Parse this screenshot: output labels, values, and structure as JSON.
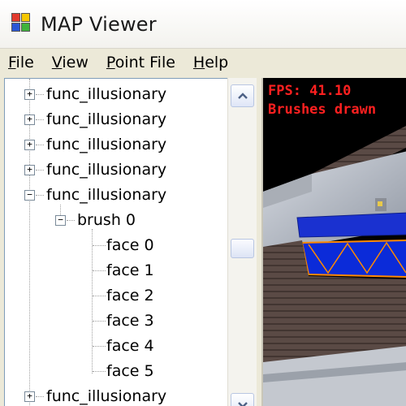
{
  "window": {
    "title": "MAP Viewer",
    "icon": "app-windows-icon"
  },
  "menu": [
    {
      "label": "File",
      "mnemonic": "F",
      "rest": "ile"
    },
    {
      "label": "View",
      "mnemonic": "V",
      "rest": "iew"
    },
    {
      "label": "Point File",
      "mnemonic": "P",
      "rest": "oint File"
    },
    {
      "label": "Help",
      "mnemonic": "H",
      "rest": "elp"
    }
  ],
  "tree": {
    "entities": [
      {
        "label": "func_illusionary",
        "expanded": false
      },
      {
        "label": "func_illusionary",
        "expanded": false
      },
      {
        "label": "func_illusionary",
        "expanded": false
      },
      {
        "label": "func_illusionary",
        "expanded": false
      },
      {
        "label": "func_illusionary",
        "expanded": true
      }
    ],
    "brush": {
      "label": "brush 0",
      "expanded": true
    },
    "faces": [
      "face 0",
      "face 1",
      "face 2",
      "face 3",
      "face 4",
      "face 5"
    ],
    "after": {
      "label": "func_illusionary",
      "expanded": false
    }
  },
  "scrollbar": {
    "up_icon": "chevron-up-icon",
    "down_icon": "chevron-down-icon"
  },
  "viewport": {
    "fps": "FPS: 41.10",
    "brushes": "Brushes drawn",
    "hud_color": "#ff2020",
    "selection_color": "#0b2bd9",
    "outline_color": "#ff8a00"
  }
}
